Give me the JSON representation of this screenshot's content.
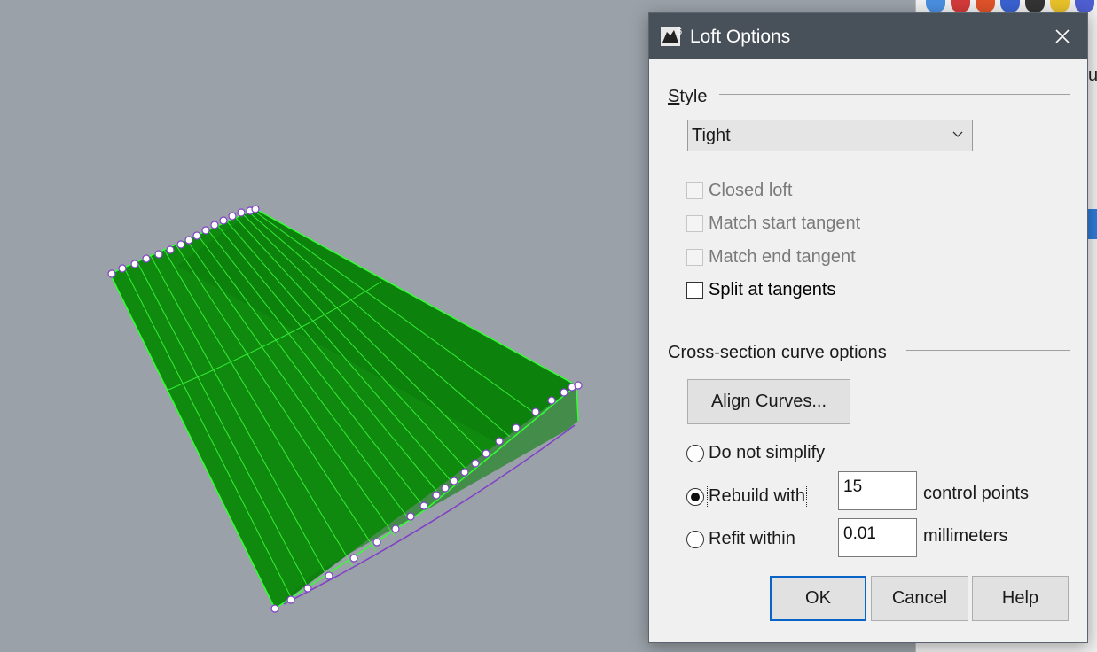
{
  "dialog": {
    "title": "Loft Options",
    "app_icon": "rhino-6-icon",
    "close_icon": "close-icon"
  },
  "style_section": {
    "label": "Style",
    "selected": "Tight"
  },
  "checkboxes": [
    {
      "label": "Closed loft",
      "checked": false,
      "enabled": false
    },
    {
      "label": "Match start tangent",
      "checked": false,
      "enabled": false
    },
    {
      "label": "Match end tangent",
      "checked": false,
      "enabled": false
    },
    {
      "label": "Split at tangents",
      "checked": false,
      "enabled": true
    }
  ],
  "cross_section": {
    "label": "Cross-section curve options",
    "align_button": "Align Curves...",
    "options": [
      {
        "label": "Do not simplify",
        "checked": false
      },
      {
        "label": "Rebuild with",
        "checked": true,
        "value": "15",
        "unit": "control points"
      },
      {
        "label": "Refit within",
        "checked": false,
        "value": "0.01",
        "unit": "millimeters"
      }
    ]
  },
  "buttons": {
    "ok": "OK",
    "cancel": "Cancel",
    "help": "Help"
  },
  "side_panel": {
    "partial_text": "u"
  },
  "colors": {
    "surface": "#0f8a0f",
    "surface_dark": "#0b7a0b",
    "edge": "#33ff33",
    "curve": "#8040c8",
    "viewport_bg": "#9aa1a8",
    "title_bar": "#485059"
  }
}
